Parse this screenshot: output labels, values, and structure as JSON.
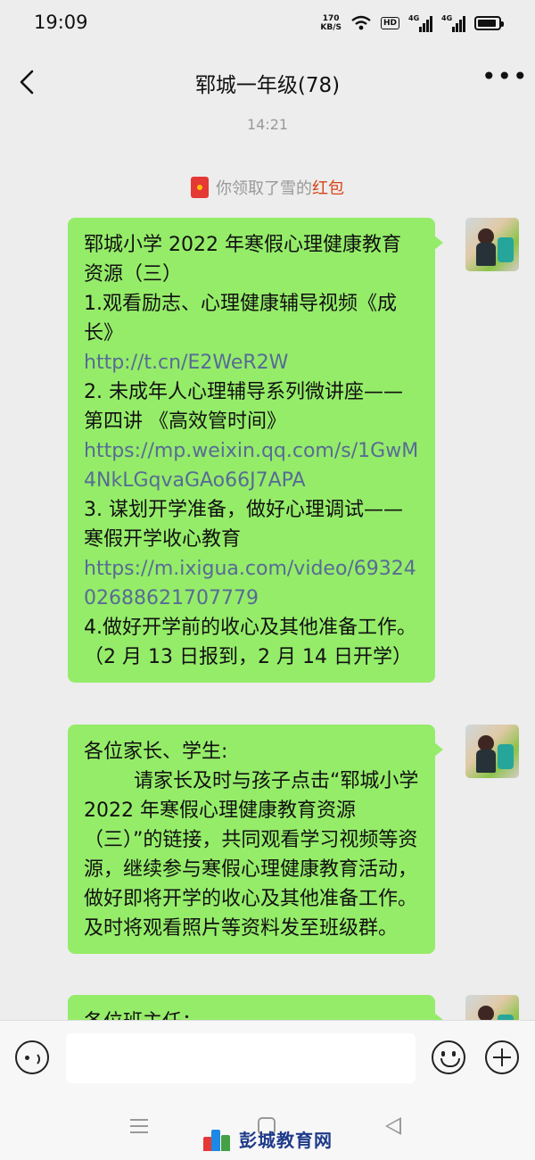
{
  "status_bar": {
    "time": "19:09",
    "net_speed_value": "170",
    "net_speed_unit": "KB/S",
    "hd_badge": "HD",
    "sim1_label": "4G",
    "sim2_label": "4G",
    "battery_level": 0.9
  },
  "header": {
    "back_icon": "chevron-left-icon",
    "title": "郓城一年级(78)",
    "more_icon": "ellipsis-icon",
    "more_label": "•••"
  },
  "chat": {
    "timestamp": "14:21",
    "system_message": {
      "icon": "red-packet-icon",
      "prefix": "你领取了雪的",
      "highlight": "红包",
      "highlight_color": "#d84315"
    },
    "messages": [
      {
        "lines": [
          {
            "text": "郓城小学 2022 年寒假心理健康教育资源（三）",
            "link": false
          },
          {
            "text": "1.观看励志、心理健康辅导视频《成长》",
            "link": false
          },
          {
            "text": " http://t.cn/E2WeR2W",
            "link": true
          },
          {
            "text": "2. 未成年人心理辅导系列微讲座——第四讲 《高效管时间》",
            "link": false
          },
          {
            "text": "https://mp.weixin.qq.com/s/1GwM4NkLGqvaGAo66J7APA",
            "link": true
          },
          {
            "text": "3. 谋划开学准备，做好心理调试——寒假开学收心教育",
            "link": false
          },
          {
            "text": "https://m.ixigua.com/video/6932402688621707779",
            "link": true
          },
          {
            "text": "4.做好开学前的收心及其他准备工作。（2 月 13 日报到，2 月 14 日开学）",
            "link": false
          }
        ]
      },
      {
        "greeting": "各位家长、学生:",
        "body": "请家长及时与孩子点击“郓城小学 2022 年寒假心理健康教育资源（三）”的链接，共同观看学习视频等资源，继续参与寒假心理健康教育活动，做好即将开学的收心及其他准备工作。及时将观看照片等资料发至班级群。"
      },
      {
        "partial_text": "各位班主任："
      }
    ]
  },
  "input_bar": {
    "voice_icon": "voice-icon",
    "input_value": "",
    "emoji_icon": "emoji-icon",
    "plus_icon": "plus-icon"
  },
  "nav_bar": {
    "menu_icon": "menu-icon",
    "home_icon": "home-icon",
    "back_icon": "back-triangle-icon"
  },
  "watermark": {
    "text": "彭城教育网"
  },
  "colors": {
    "bubble": "#95ec69",
    "link": "#576b95",
    "background": "#ededed"
  }
}
